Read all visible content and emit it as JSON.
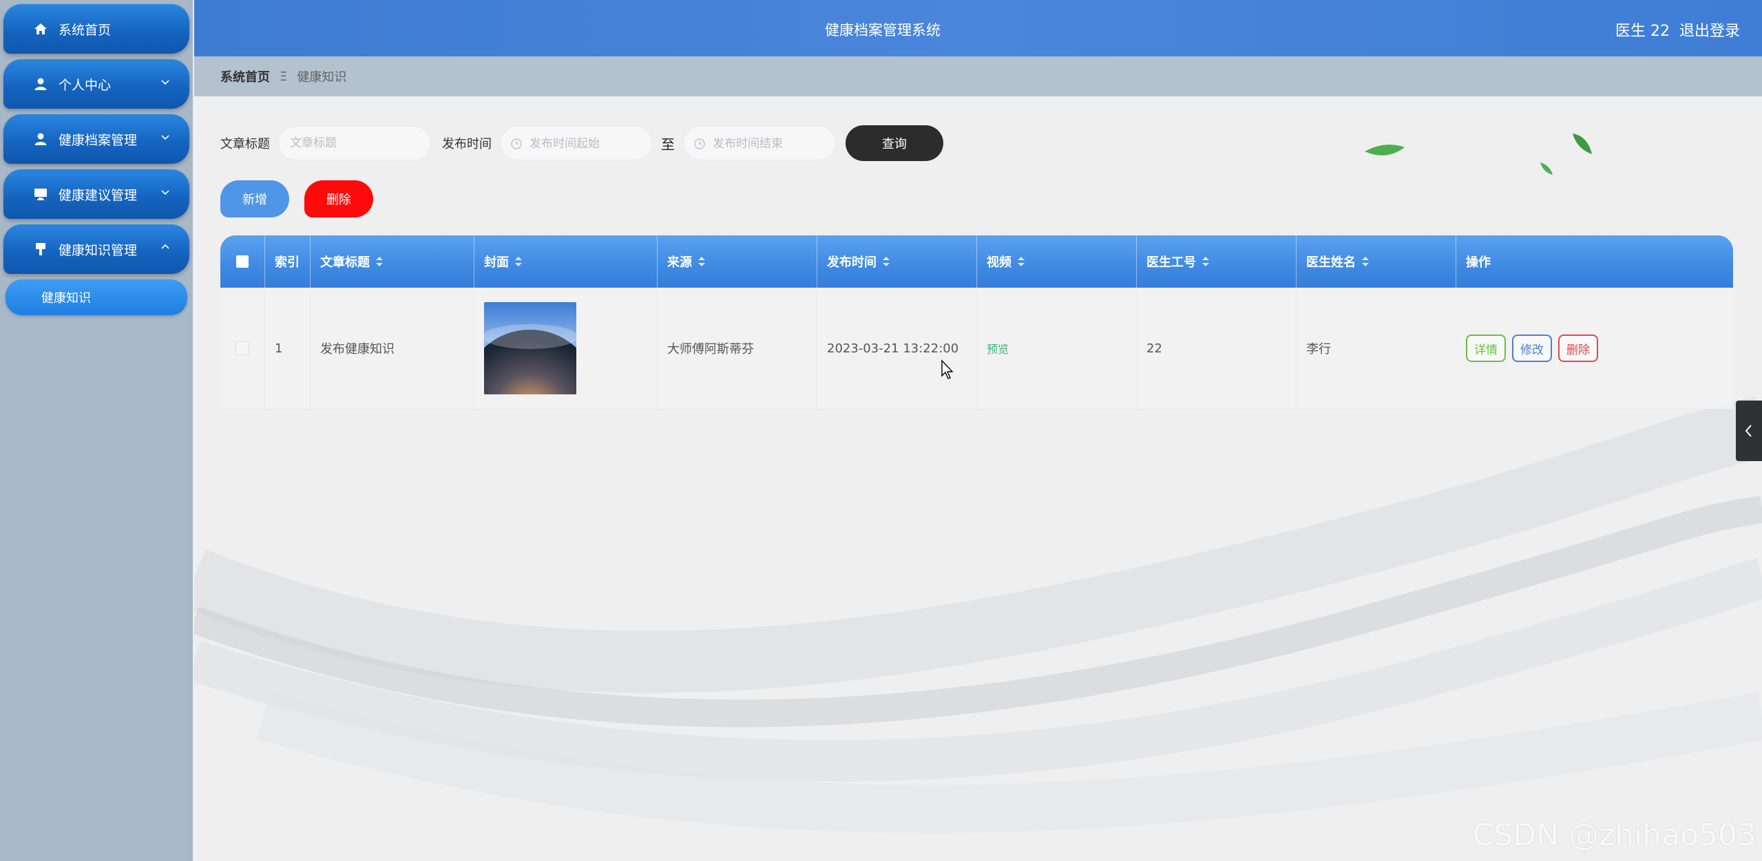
{
  "sidebar": {
    "items": [
      {
        "label": "系统首页",
        "icon": "home-icon",
        "has_arrow": false
      },
      {
        "label": "个人中心",
        "icon": "user-icon",
        "has_arrow": true
      },
      {
        "label": "健康档案管理",
        "icon": "user-icon",
        "has_arrow": true
      },
      {
        "label": "健康建议管理",
        "icon": "monitor-icon",
        "has_arrow": true
      },
      {
        "label": "健康知识管理",
        "icon": "pin-icon",
        "has_arrow": true,
        "expanded": true
      }
    ],
    "sub_item": "健康知识"
  },
  "header": {
    "title": "健康档案管理系统",
    "user": "医生 22",
    "logout": "退出登录"
  },
  "breadcrumb": {
    "home": "系统首页",
    "separator": "Ξ",
    "current": "健康知识"
  },
  "search": {
    "title_label": "文章标题",
    "title_placeholder": "文章标题",
    "time_label": "发布时间",
    "start_placeholder": "发布时间起始",
    "to_label": "至",
    "end_placeholder": "发布时间结束",
    "query_button": "查询"
  },
  "actions": {
    "add": "新增",
    "delete": "删除"
  },
  "table": {
    "headers": {
      "index": "索引",
      "title": "文章标题",
      "cover": "封面",
      "source": "来源",
      "time": "发布时间",
      "video": "视频",
      "doctor_id": "医生工号",
      "doctor_name": "医生姓名",
      "ops": "操作"
    },
    "rows": [
      {
        "index": "1",
        "title": "发布健康知识",
        "source": "大师傅阿斯蒂芬",
        "time": "2023-03-21 13:22:00",
        "video": "预览",
        "doctor_id": "22",
        "doctor_name": "李行",
        "ops": {
          "detail": "详情",
          "edit": "修改",
          "delete": "删除"
        }
      }
    ]
  },
  "watermark": "CSDN @zhihao503",
  "colors": {
    "header": "#4282d8",
    "sidebar_bg": "#a9b8c7",
    "menu_item": "#1565c0",
    "add_button": "#4f95e8",
    "delete_button": "#ff0a0a",
    "query_button": "#2c2c2c",
    "table_header": "#4a90e6"
  }
}
